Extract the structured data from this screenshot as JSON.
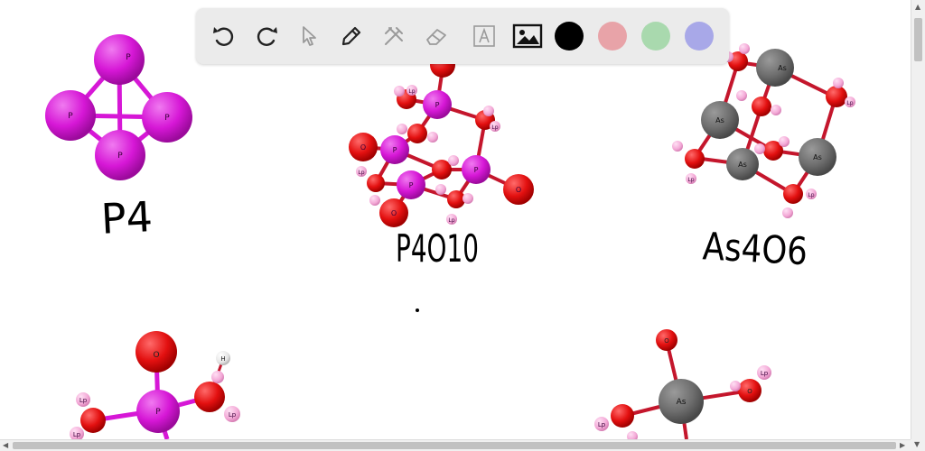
{
  "toolbar": {
    "tools": [
      "undo-icon",
      "redo-icon",
      "pointer-icon",
      "pencil-icon",
      "tools-icon",
      "eraser-icon",
      "text-icon",
      "image-icon"
    ],
    "colors": [
      "#000000",
      "#e8a3a8",
      "#a9d9ae",
      "#a8a8e8"
    ]
  },
  "molecules": {
    "p4": {
      "atom_label": "P",
      "caption": "P4"
    },
    "p4o10": {
      "caption": "P4O10"
    },
    "as4o6": {
      "caption": "As4O6"
    },
    "acid_p": {
      "atom_p": "P",
      "atom_o": "O",
      "atom_h": "H",
      "lone_pair": "Lp"
    },
    "acid_as": {
      "atom_as": "As",
      "atom_o": "O",
      "lone_pair": "Lp"
    }
  },
  "labels": {
    "p": "P",
    "o": "O",
    "as": "As",
    "lp": "Lp",
    "h": "H"
  }
}
